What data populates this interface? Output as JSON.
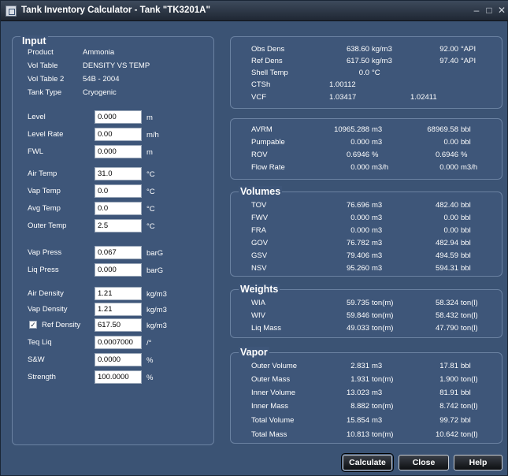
{
  "window": {
    "title": "Tank Inventory Calculator - Tank \"TK3201A\"",
    "minimize_glyph": "–",
    "maximize_glyph": "□",
    "close_glyph": "✕"
  },
  "input": {
    "heading": "Input",
    "product_label": "Product",
    "product_value": "Ammonia",
    "voltable_label": "Vol Table",
    "voltable_value": "DENSITY VS TEMP",
    "voltable2_label": "Vol Table 2",
    "voltable2_value": "54B - 2004",
    "tanktype_label": "Tank Type",
    "tanktype_value": "Cryogenic",
    "fields": {
      "level": {
        "label": "Level",
        "value": "0.000",
        "unit": "m"
      },
      "level_rate": {
        "label": "Level Rate",
        "value": "0.00",
        "unit": "m/h"
      },
      "fwl": {
        "label": "FWL",
        "value": "0.000",
        "unit": "m"
      },
      "air_temp": {
        "label": "Air Temp",
        "value": "31.0",
        "unit": "°C"
      },
      "vap_temp": {
        "label": "Vap Temp",
        "value": "0.0",
        "unit": "°C"
      },
      "avg_temp": {
        "label": "Avg Temp",
        "value": "0.0",
        "unit": "°C"
      },
      "outer_temp": {
        "label": "Outer Temp",
        "value": "2.5",
        "unit": "°C"
      },
      "vap_press": {
        "label": "Vap Press",
        "value": "0.067",
        "unit": "barG"
      },
      "liq_press": {
        "label": "Liq Press",
        "value": "0.000",
        "unit": "barG"
      },
      "air_density": {
        "label": "Air Density",
        "value": "1.21",
        "unit": "kg/m3"
      },
      "vap_density": {
        "label": "Vap Density",
        "value": "1.21",
        "unit": "kg/m3"
      },
      "ref_density": {
        "label": "Ref Density",
        "value": "617.50",
        "unit": "kg/m3",
        "checked": true
      },
      "teq_liq": {
        "label": "Teq Liq",
        "value": "0.0007000",
        "unit": "/°"
      },
      "sw": {
        "label": "S&W",
        "value": "0.0000",
        "unit": "%"
      },
      "strength": {
        "label": "Strength",
        "value": "100.0000",
        "unit": "%"
      }
    },
    "checkmark": "✓"
  },
  "density": {
    "obs_dens": {
      "label": "Obs Dens",
      "value": "638.60",
      "unit": "kg/m3",
      "value2": "92.00",
      "unit2": "°API"
    },
    "ref_dens": {
      "label": "Ref Dens",
      "value": "617.50",
      "unit": "kg/m3",
      "value2": "97.40",
      "unit2": "°API"
    },
    "shell_temp": {
      "label": "Shell Temp",
      "value": "0.0",
      "unit": "°C"
    },
    "ctsh": {
      "label": "CTSh",
      "value": "1.00112"
    },
    "vcf": {
      "label": "VCF",
      "value": "1.03417",
      "value2": "1.02411"
    }
  },
  "avrm": {
    "avrm": {
      "label": "AVRM",
      "value": "10965.288",
      "unit": "m3",
      "value2": "68969.58",
      "unit2": "bbl"
    },
    "pumpable": {
      "label": "Pumpable",
      "value": "0.000",
      "unit": "m3",
      "value2": "0.00",
      "unit2": "bbl"
    },
    "rov": {
      "label": "ROV",
      "value": "0.6946",
      "unit": "%",
      "value2": "0.6946",
      "unit2": "%"
    },
    "flow_rate": {
      "label": "Flow Rate",
      "value": "0.000",
      "unit": "m3/h",
      "value2": "0.000",
      "unit2": "m3/h"
    }
  },
  "volumes": {
    "heading": "Volumes",
    "rows": [
      {
        "label": "TOV",
        "value": "76.696",
        "unit": "m3",
        "value2": "482.40",
        "unit2": "bbl"
      },
      {
        "label": "FWV",
        "value": "0.000",
        "unit": "m3",
        "value2": "0.00",
        "unit2": "bbl"
      },
      {
        "label": "FRA",
        "value": "0.000",
        "unit": "m3",
        "value2": "0.00",
        "unit2": "bbl"
      },
      {
        "label": "GOV",
        "value": "76.782",
        "unit": "m3",
        "value2": "482.94",
        "unit2": "bbl"
      },
      {
        "label": "GSV",
        "value": "79.406",
        "unit": "m3",
        "value2": "494.59",
        "unit2": "bbl"
      },
      {
        "label": "NSV",
        "value": "95.260",
        "unit": "m3",
        "value2": "594.31",
        "unit2": "bbl"
      }
    ]
  },
  "weights": {
    "heading": "Weights",
    "rows": [
      {
        "label": "WIA",
        "value": "59.735",
        "unit": "ton(m)",
        "value2": "58.324",
        "unit2": "ton(l)"
      },
      {
        "label": "WIV",
        "value": "59.846",
        "unit": "ton(m)",
        "value2": "58.432",
        "unit2": "ton(l)"
      },
      {
        "label": "Liq Mass",
        "value": "49.033",
        "unit": "ton(m)",
        "value2": "47.790",
        "unit2": "ton(l)"
      }
    ]
  },
  "vapor": {
    "heading": "Vapor",
    "rows": [
      {
        "label": "Outer Volume",
        "value": "2.831",
        "unit": "m3",
        "value2": "17.81",
        "unit2": "bbl"
      },
      {
        "label": "Outer Mass",
        "value": "1.931",
        "unit": "ton(m)",
        "value2": "1.900",
        "unit2": "ton(l)"
      },
      {
        "label": "Inner Volume",
        "value": "13.023",
        "unit": "m3",
        "value2": "81.91",
        "unit2": "bbl"
      },
      {
        "label": "Inner Mass",
        "value": "8.882",
        "unit": "ton(m)",
        "value2": "8.742",
        "unit2": "ton(l)"
      },
      {
        "label": "Total Volume",
        "value": "15.854",
        "unit": "m3",
        "value2": "99.72",
        "unit2": "bbl"
      },
      {
        "label": "Total Mass",
        "value": "10.813",
        "unit": "ton(m)",
        "value2": "10.642",
        "unit2": "ton(l)"
      }
    ]
  },
  "buttons": {
    "calculate": "Calculate",
    "close": "Close",
    "help": "Help"
  }
}
